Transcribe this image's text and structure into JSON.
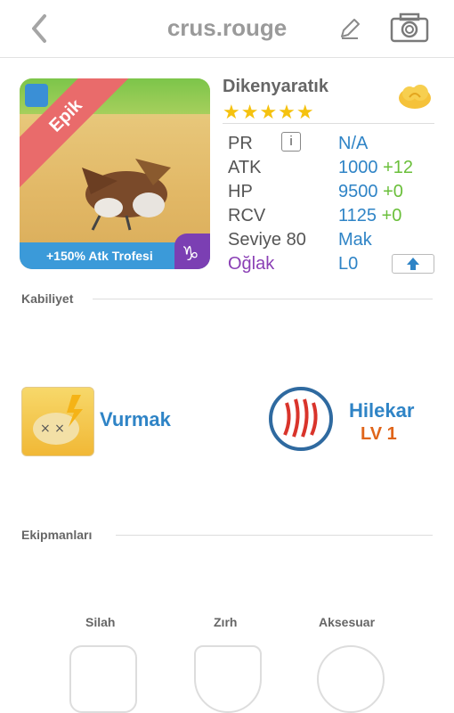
{
  "header": {
    "title": "crus.rouge"
  },
  "card": {
    "rarity": "Epik",
    "trophy_text": "+150% Atk Trofesi"
  },
  "monster": {
    "name": "Dikenyaratık",
    "stars": "★★★★★"
  },
  "stats": {
    "pr_label": "PR",
    "pr_value": "N/A",
    "atk_label": "ATK",
    "atk_value": "1000",
    "atk_bonus": "+12",
    "hp_label": "HP",
    "hp_value": "9500",
    "hp_bonus": "+0",
    "rcv_label": "RCV",
    "rcv_value": "1125",
    "rcv_bonus": "+0",
    "level_label": "Seviye 80",
    "level_value": "Mak",
    "sign_label": "Oğlak",
    "sign_value": "L0"
  },
  "abilities": {
    "title": "Kabiliyet",
    "active_name": "Vurmak",
    "passive_name": "Hilekar",
    "passive_level": "LV 1"
  },
  "equipment": {
    "title": "Ekipmanları",
    "weapon": "Silah",
    "armor": "Zırh",
    "accessory": "Aksesuar"
  },
  "colors": {
    "accent_blue": "#2f84c6",
    "bonus_green": "#6abf3a",
    "sign_purple": "#8a3fb5",
    "level_orange": "#e0651a",
    "star_yellow": "#f5c20f"
  }
}
